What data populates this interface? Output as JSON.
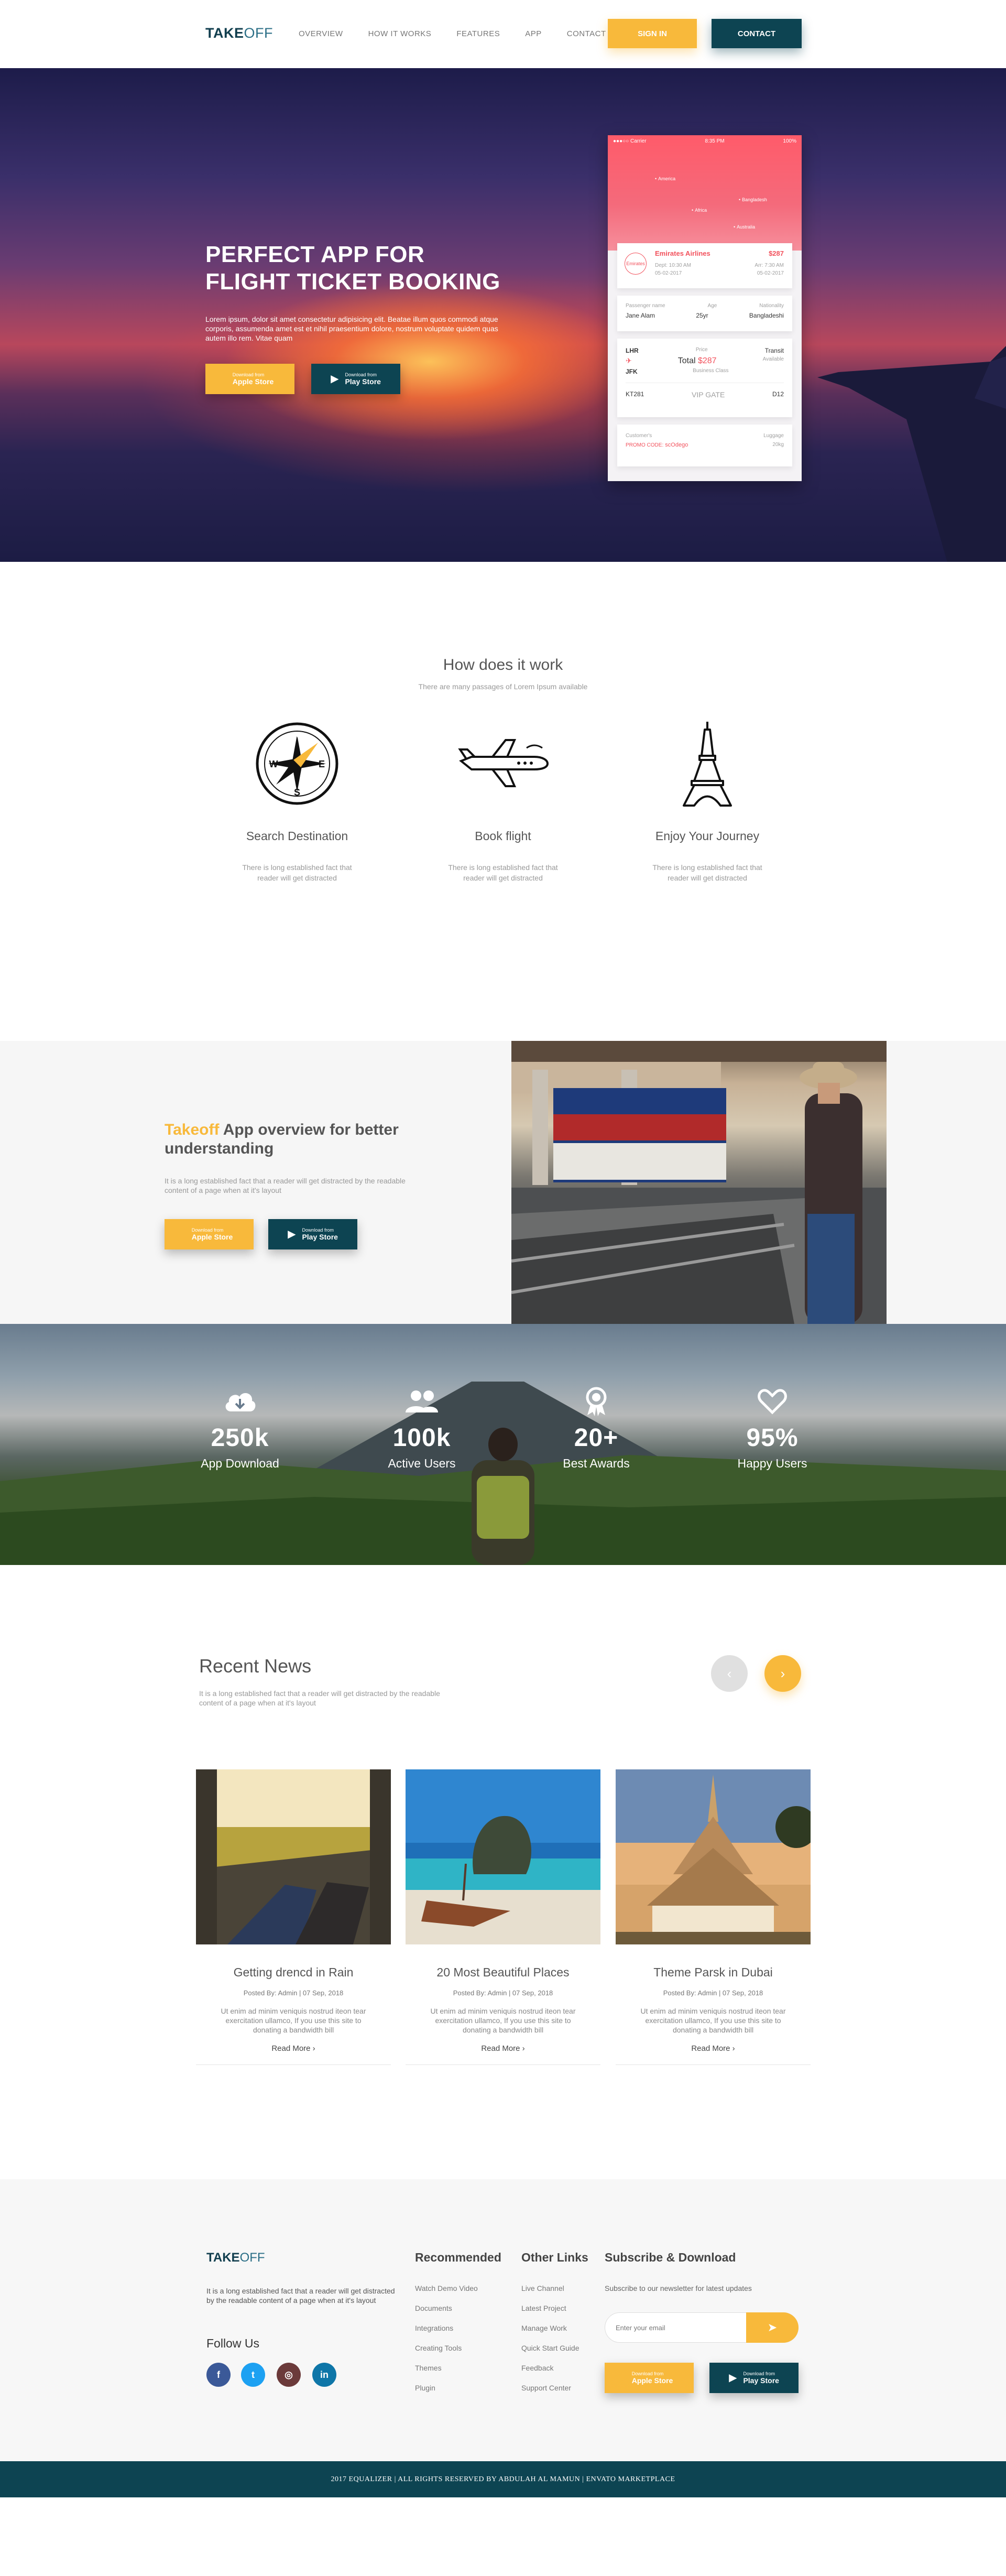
{
  "nav": {
    "logo_bold": "TAKE",
    "logo_thin": "OFF",
    "links": [
      "OVERVIEW",
      "HOW IT WORKS",
      "FEATURES",
      "APP",
      "CONTACT"
    ],
    "signin_label": "SIGN IN",
    "contact_label": "CONTACT"
  },
  "hero": {
    "title_line1": "PERFECT APP FOR",
    "title_line2": "FLIGHT TICKET BOOKING",
    "text": "Lorem ipsum, dolor sit amet consectetur adipisicing elit. Beatae illum quos commodi atque corporis, assumenda amet est et nihil praesentium dolore, nostrum voluptate quidem quas autem illo rem. Vitae quam",
    "apple_small": "Download from",
    "apple_big": "Apple Store",
    "play_small": "Download from",
    "play_big": "Play Store"
  },
  "phone": {
    "carrier": "●●●○○ Carrier",
    "time": "8:35 PM",
    "battery": "100%",
    "places": [
      "America",
      "Bangladesh",
      "Africa",
      "Australia"
    ],
    "airline_logo": "Emirates",
    "airline": "Emirates Airlines",
    "price": "$287",
    "dept_label": "Dept: 10:30 AM",
    "dept_date": "05-02-2017",
    "arr_label": "Arr: 7:30 AM",
    "arr_date": "05-02-2017",
    "passenger_label": "Passenger name",
    "passenger": "Jane Alam",
    "age_label": "Age",
    "age": "25yr",
    "nationality_label": "Nationality",
    "nationality": "Bangladeshi",
    "from": "LHR",
    "to": "JFK",
    "price_label": "Price",
    "total_label": "Total",
    "total": "$287",
    "class_label": "Business Class",
    "transit": "Transit",
    "transit_status": "Available",
    "flight_no": "KT281",
    "gate": "VIP GATE",
    "seat": "D12",
    "customer_label": "Customer's",
    "promo_label": "PROMO CODE:",
    "promo": "scOdego",
    "weight_label": "Luggage",
    "weight": "20kg"
  },
  "how": {
    "title": "How does it work",
    "subtitle": "There are many passages of Lorem Ipsum available",
    "steps": [
      {
        "title": "Search Destination",
        "text": "There is long established fact that reader will get distracted"
      },
      {
        "title": "Book flight",
        "text": "There is long established fact that reader will get distracted"
      },
      {
        "title": "Enjoy Your Journey",
        "text": "There is long established fact that reader will get distracted"
      }
    ]
  },
  "overview": {
    "title_hl": "Takeoff",
    "title_rest": " App overview for better understanding",
    "text": "It is a long established fact that a reader will get distracted by the readable content of a page when at it's layout",
    "apple_small": "Download from",
    "apple_big": "Apple Store",
    "play_small": "Download from",
    "play_big": "Play Store"
  },
  "stats": [
    {
      "icon": "cloud-download-icon",
      "value": "250k",
      "label": "App Download"
    },
    {
      "icon": "users-icon",
      "value": "100k",
      "label": "Active Users"
    },
    {
      "icon": "award-icon",
      "value": "20+",
      "label": "Best Awards"
    },
    {
      "icon": "heart-icon",
      "value": "95%",
      "label": "Happy Users"
    }
  ],
  "news": {
    "title": "Recent News",
    "text": "It is a long established fact that a reader will get distracted by the readable content of a page when at it's layout",
    "cards": [
      {
        "title": "Getting drencd in Rain",
        "meta": "Posted By: Admin | 07 Sep, 2018",
        "desc": "Ut enim ad minim veniquis nostrud iteon tear exercitation ullamco, If you use this site to donating a bandwidth bill",
        "more": "Read More ›"
      },
      {
        "title": "20 Most Beautiful Places",
        "meta": "Posted By: Admin | 07 Sep, 2018",
        "desc": "Ut enim ad minim veniquis nostrud iteon tear exercitation ullamco, If you use this site to donating a bandwidth bill",
        "more": "Read More ›"
      },
      {
        "title": "Theme Parsk in Dubai",
        "meta": "Posted By: Admin | 07 Sep, 2018",
        "desc": "Ut enim ad minim veniquis nostrud iteon tear exercitation ullamco, If you use this site to donating a bandwidth bill",
        "more": "Read More ›"
      }
    ]
  },
  "footer": {
    "logo_bold": "TAKE",
    "logo_thin": "OFF",
    "about": "It is a long established fact that a reader will get distracted by the readable content of a page when at it's layout",
    "follow": "Follow Us",
    "recommended_title": "Recommended",
    "recommended": [
      "Watch Demo Video",
      "Documents",
      "Integrations",
      "Creating Tools",
      "Themes",
      "Plugin"
    ],
    "other_title": "Other Links",
    "other": [
      "Live Channel",
      "Latest Project",
      "Manage Work",
      "Quick Start Guide",
      "Feedback",
      "Support Center"
    ],
    "subscribe_title": "Subscribe & Download",
    "subscribe_text": "Subscribe to our newsletter for latest updates",
    "email_placeholder": "Enter your email",
    "apple_small": "Download from",
    "apple_big": "Apple Store",
    "play_small": "Download from",
    "play_big": "Play Store"
  },
  "copyright": "2017 EQUALIZER | ALL RIGHTS RESERVED BY ABDULAH AL MAMUN | ENVATO MARKETPLACE",
  "colors": {
    "accent": "#f8b93b",
    "brand": "#0d4452",
    "red": "#f2525d"
  }
}
